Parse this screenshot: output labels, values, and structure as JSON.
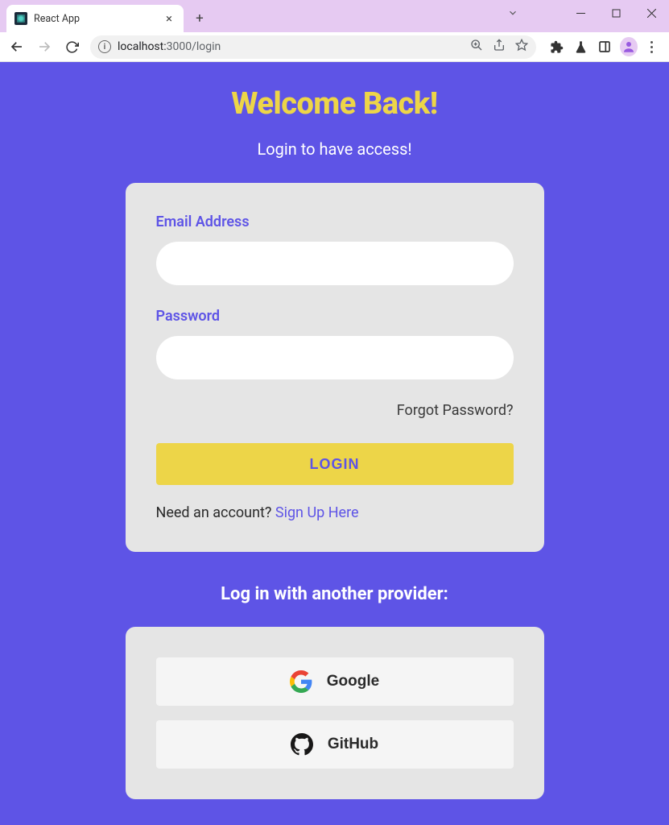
{
  "browser": {
    "tab_title": "React App",
    "url_host": "localhost:",
    "url_port_path": "3000/login"
  },
  "page": {
    "heading": "Welcome Back!",
    "subtitle": "Login to have access!",
    "email_label": "Email Address",
    "password_label": "Password",
    "forgot_password": "Forgot Password?",
    "login_button": "LOGIN",
    "need_account": "Need an account? ",
    "signup_link": "Sign Up Here",
    "provider_heading": "Log in with another provider:",
    "providers": {
      "google": "Google",
      "github": "GitHub"
    }
  }
}
